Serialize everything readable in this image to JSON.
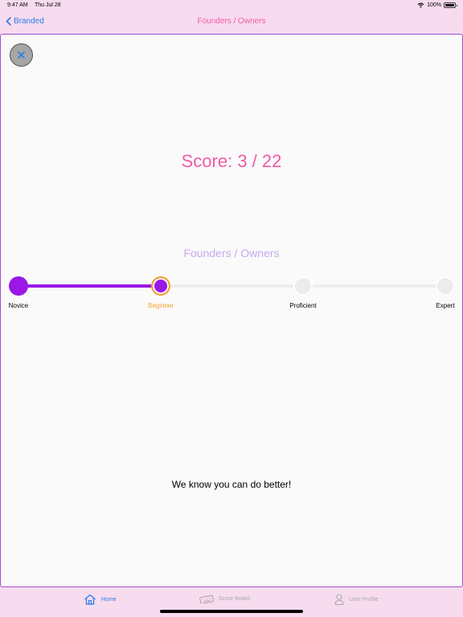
{
  "status_bar": {
    "time": "9:47 AM",
    "date": "Thu Jul 28",
    "battery": "100%",
    "battery_level": 1.0
  },
  "nav": {
    "back_label": "Branded",
    "title": "Founders / Owners"
  },
  "result": {
    "score_text": "Score: 3 / 22",
    "category": "Founders / Owners",
    "message": "We know you can do better!"
  },
  "progress": {
    "levels": [
      "Novice",
      "Beginner",
      "Proficient",
      "Expert"
    ],
    "current_index": 1
  },
  "tab_bar": {
    "tabs": [
      {
        "label": "Home",
        "icon": "home-icon",
        "active": true
      },
      {
        "label": "Score Board",
        "icon": "keyboard-icon",
        "active": false
      },
      {
        "label": "User Profile",
        "icon": "person-icon",
        "active": false
      }
    ]
  },
  "colors": {
    "accent_pink": "#f15aa7",
    "accent_purple": "#9a17e6",
    "current_ring": "#f5a12a",
    "link_blue": "#2d7ce6",
    "background": "#f7dbef"
  }
}
